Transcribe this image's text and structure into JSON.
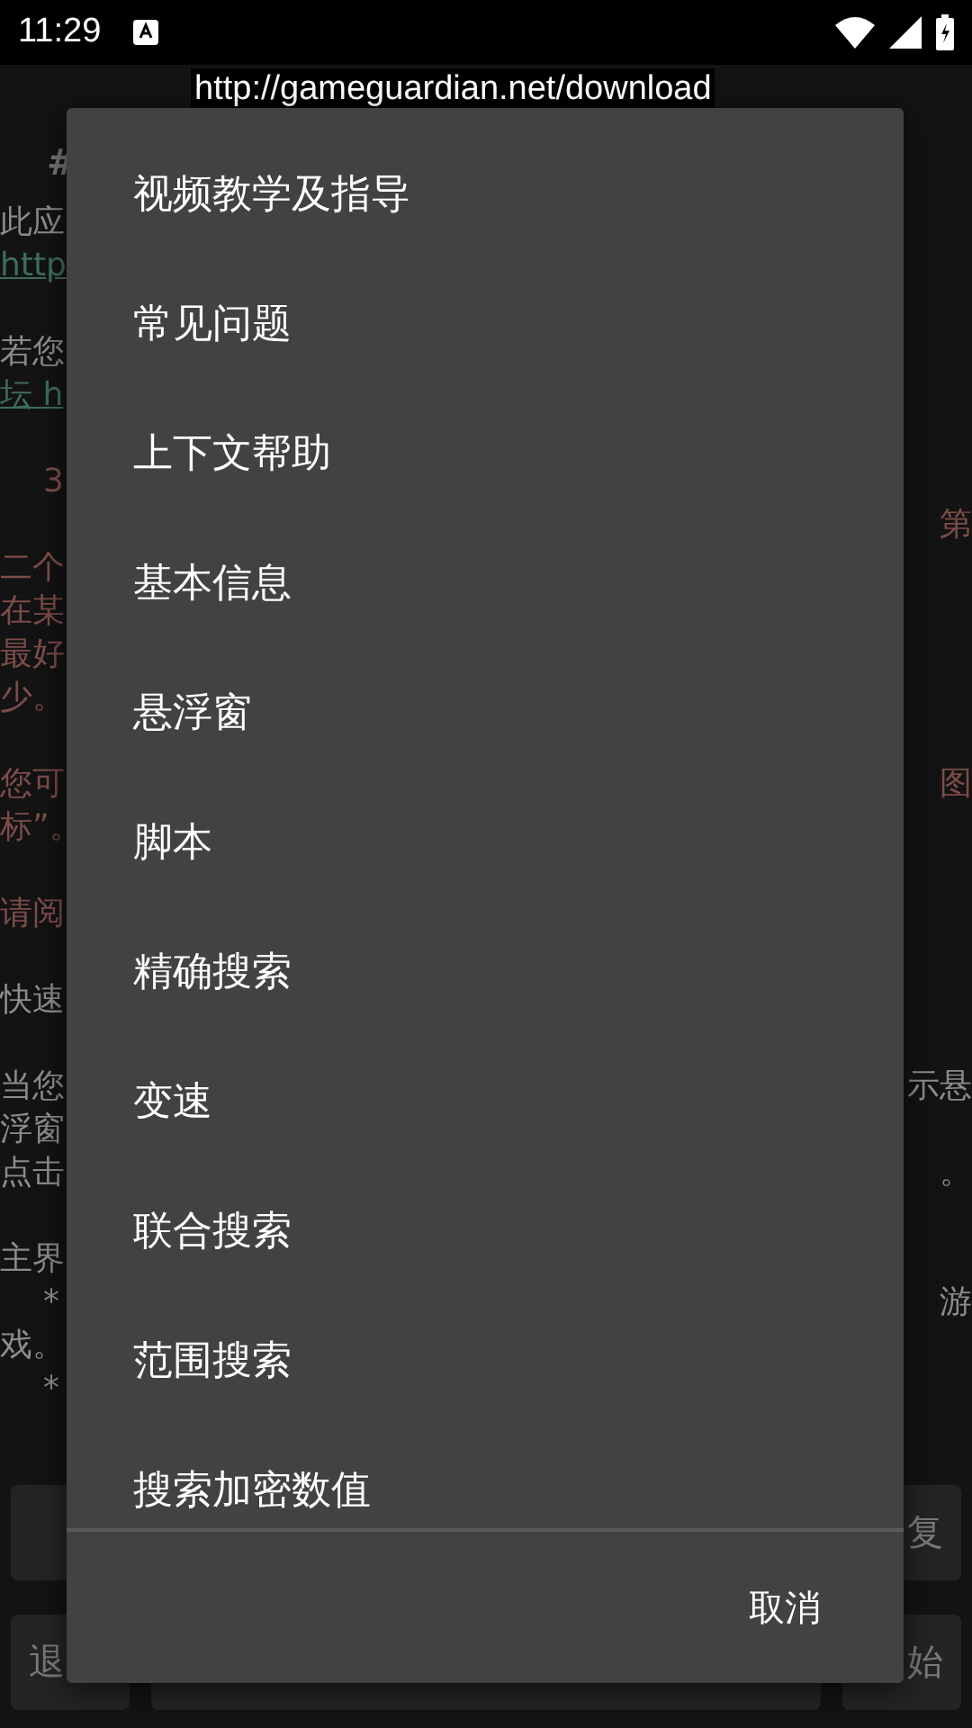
{
  "status_bar": {
    "time": "11:29"
  },
  "url_tooltip": "http://gameguardian.net/download",
  "background": {
    "heading": "#",
    "rows": [
      {
        "left": {
          "text": "此应",
          "kind": "plain"
        }
      },
      {
        "left": {
          "text": "http",
          "kind": "link"
        }
      },
      {},
      {
        "left": {
          "text": "若您",
          "kind": "plain"
        }
      },
      {
        "left": {
          "text": "坛 h",
          "kind": "link"
        }
      },
      {},
      {
        "left": {
          "text": "3",
          "kind": "red",
          "indent": true
        }
      },
      {
        "right": {
          "text": "第",
          "kind": "red"
        }
      },
      {
        "left": {
          "text": "二个",
          "kind": "red"
        }
      },
      {
        "left": {
          "text": "在某",
          "kind": "red"
        }
      },
      {
        "left": {
          "text": "最好",
          "kind": "red"
        }
      },
      {
        "left": {
          "text": "少。",
          "kind": "red"
        }
      },
      {},
      {
        "left": {
          "text": "您可",
          "kind": "red"
        },
        "right": {
          "text": "图",
          "kind": "red"
        }
      },
      {
        "left": {
          "text": "标”。",
          "kind": "red"
        }
      },
      {},
      {
        "left": {
          "text": "请阅",
          "kind": "red"
        }
      },
      {},
      {
        "left": {
          "text": "快速",
          "kind": "plain"
        }
      },
      {},
      {
        "left": {
          "text": "当您",
          "kind": "plain"
        },
        "right": {
          "text": "示悬",
          "kind": "plain"
        }
      },
      {
        "left": {
          "text": "浮窗",
          "kind": "plain"
        }
      },
      {
        "left": {
          "text": "点击",
          "kind": "plain"
        },
        "right": {
          "text": "。",
          "kind": "plain"
        }
      },
      {},
      {
        "left": {
          "text": "主界",
          "kind": "plain"
        }
      },
      {
        "left": {
          "text": "*",
          "kind": "plain",
          "indent": true
        },
        "right": {
          "text": "游",
          "kind": "plain"
        }
      },
      {
        "left": {
          "text": "戏。",
          "kind": "plain"
        }
      },
      {
        "left": {
          "text": "*",
          "kind": "plain",
          "indent": true
        }
      }
    ],
    "button_rows": [
      [
        {
          "kind": "small"
        },
        {
          "kind": "small",
          "label": "复"
        }
      ],
      [
        {
          "kind": "small",
          "label": "退"
        },
        {
          "kind": "wide"
        },
        {
          "kind": "small",
          "label": "始"
        }
      ]
    ]
  },
  "dialog": {
    "items": [
      "视频教学及指导",
      "常见问题",
      "上下文帮助",
      "基本信息",
      "悬浮窗",
      "脚本",
      "精确搜索",
      "变速",
      "联合搜索",
      "范围搜索",
      "搜索加密数值"
    ],
    "cancel": "取消"
  }
}
